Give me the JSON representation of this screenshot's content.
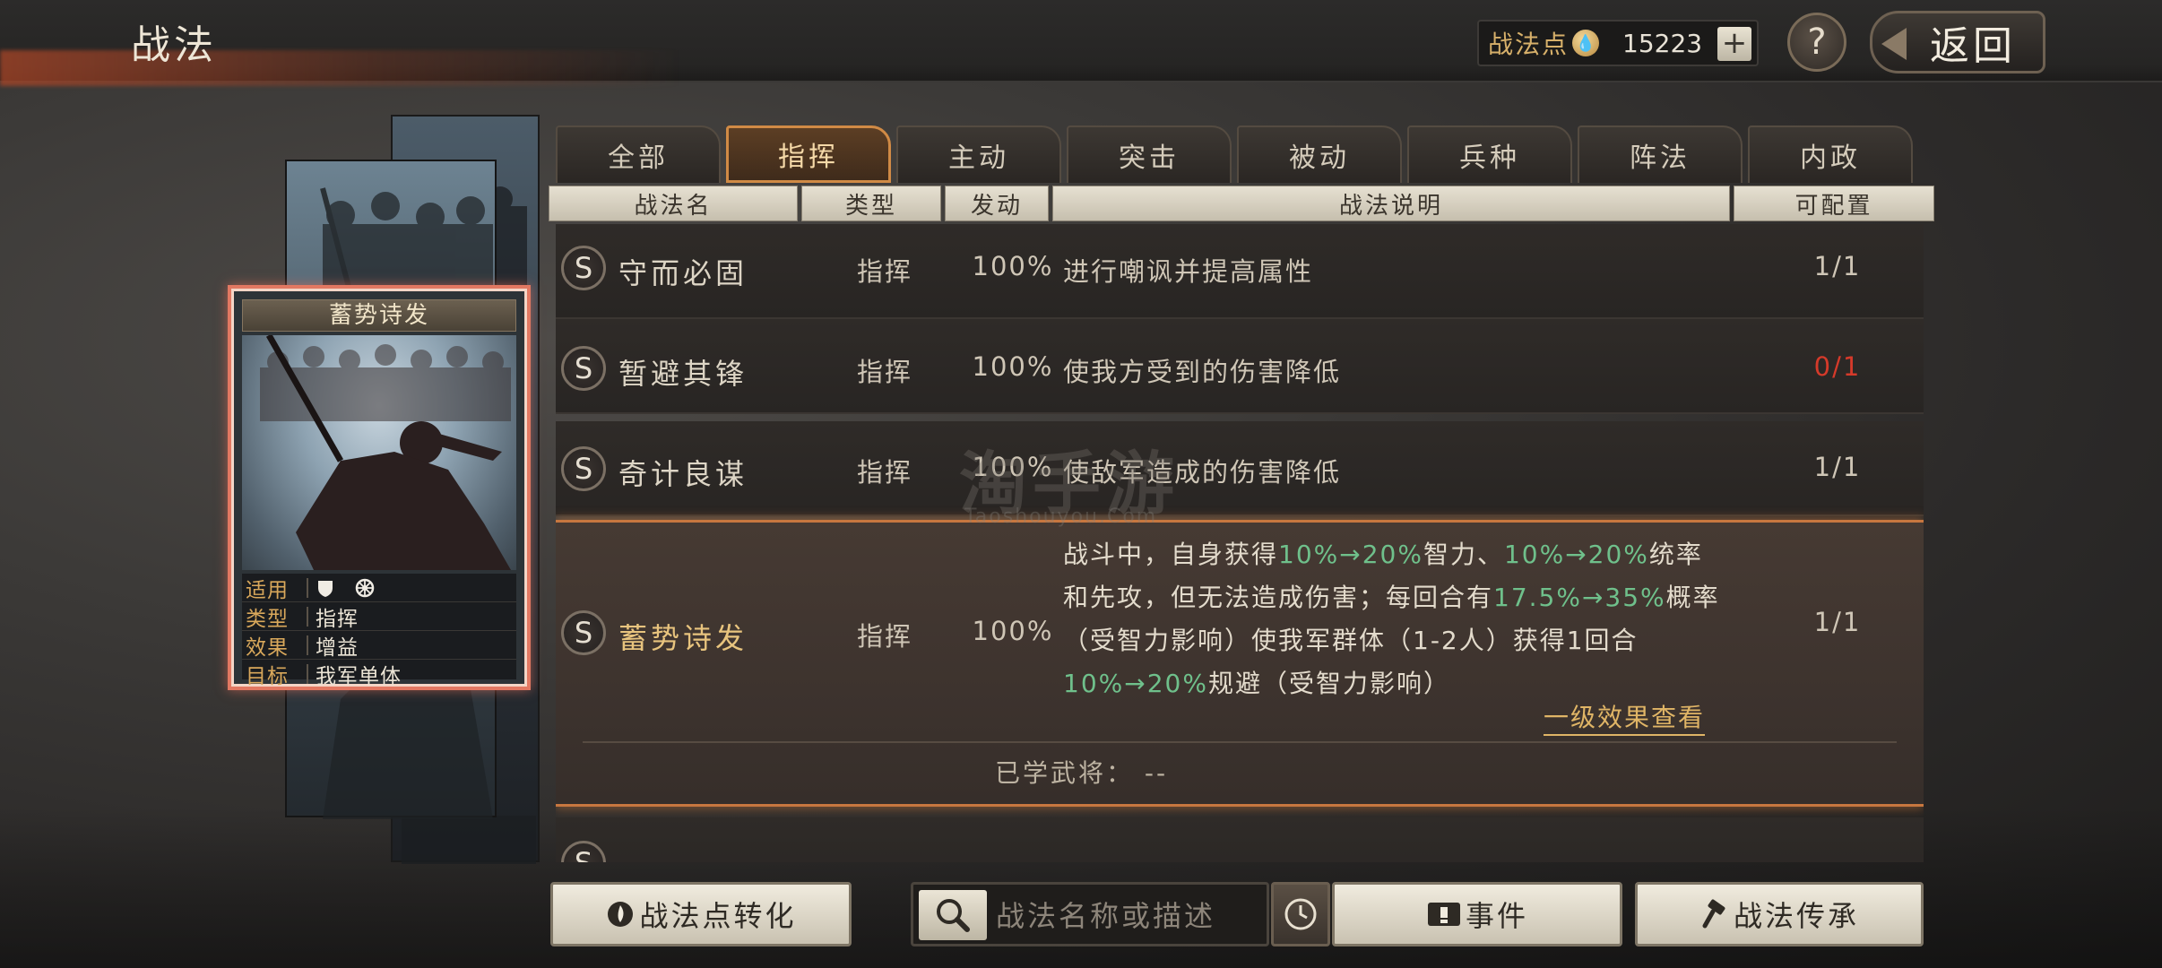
{
  "header": {
    "title": "战法",
    "points_label": "战法点",
    "points_value": "15223",
    "plus_label": "+",
    "help_label": "?",
    "back_label": "返回"
  },
  "card": {
    "title": "蓄势诗发",
    "rows": [
      {
        "key": "适用",
        "value": ""
      },
      {
        "key": "类型",
        "value": "指挥"
      },
      {
        "key": "效果",
        "value": "增益"
      },
      {
        "key": "目标",
        "value": "我军单体"
      }
    ]
  },
  "tabs": [
    "全部",
    "指挥",
    "主动",
    "突击",
    "被动",
    "兵种",
    "阵法",
    "内政"
  ],
  "active_tab": "指挥",
  "table": {
    "headers": [
      "战法名",
      "类型",
      "发动",
      "战法说明",
      "可配置"
    ],
    "rows": [
      {
        "badge": "S",
        "name": "守而必固",
        "type": "指挥",
        "rate": "100%",
        "desc": "进行嘲讽并提高属性",
        "config": "1/1"
      },
      {
        "badge": "S",
        "name": "暂避其锋",
        "type": "指挥",
        "rate": "100%",
        "desc": "使我方受到的伤害降低",
        "config": "0/1"
      },
      {
        "badge": "S",
        "name": "奇计良谋",
        "type": "指挥",
        "rate": "100%",
        "desc": "使敌军造成的伤害降低",
        "config": "1/1"
      }
    ],
    "expanded": {
      "badge": "S",
      "name": "蓄势诗发",
      "type": "指挥",
      "rate": "100%",
      "config": "1/1",
      "desc_parts": {
        "p1": "战斗中，自身获得",
        "g1": "10%→20%",
        "p2": "智力、",
        "g2": "10%→20%",
        "p3": "统率和先攻，但无法造成伤害；每回合有",
        "g3": "17.5%→35%",
        "p4": "概率（受智力影响）使我军群体（1-2人）获得1回合",
        "g4": "10%→20%",
        "p5": "规避（受智力影响）"
      },
      "detail_link": "一级效果查看",
      "learned_label": "已学武将：",
      "learned_value": "--"
    }
  },
  "watermark": {
    "main": "淘手游",
    "sub": "Taoshouyou.Com"
  },
  "bottom": {
    "convert_label": "战法点转化",
    "search_placeholder": "战法名称或描述",
    "event_label": "事件",
    "inherit_label": "战法传承"
  },
  "colors": {
    "accent": "#d08a45",
    "gold": "#e8c47e",
    "green": "#6fc08b",
    "red": "#d53a2a"
  },
  "icons": [
    "ink-drop-icon",
    "plus-icon",
    "help-icon",
    "back-arrow-icon",
    "shield-icon",
    "wheel-icon",
    "search-icon",
    "clock-icon",
    "event-icon",
    "hammer-icon"
  ]
}
